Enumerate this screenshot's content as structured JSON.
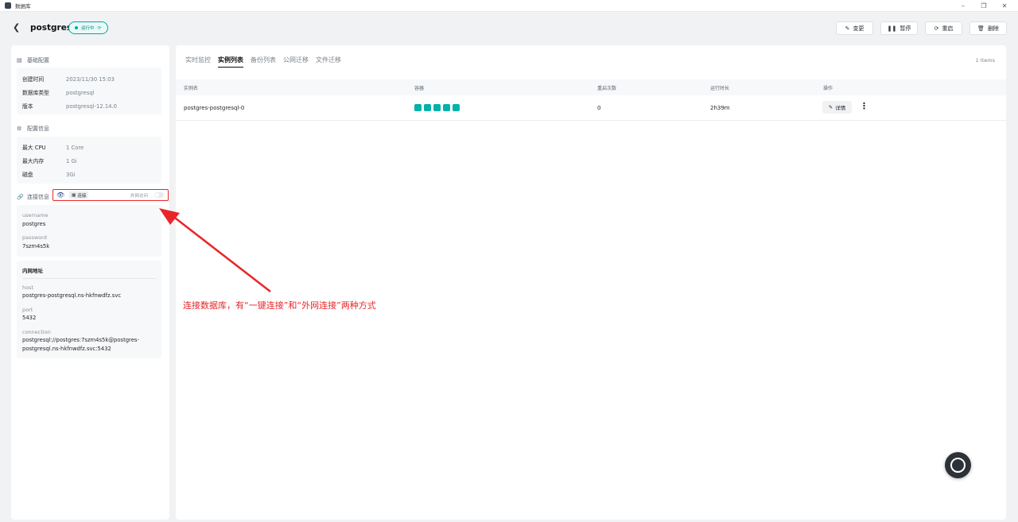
{
  "window": {
    "title": "数据库",
    "controls": [
      "–",
      "❐",
      "✕"
    ]
  },
  "header": {
    "back_icon": "chevron-left-icon",
    "db_name": "postgres",
    "status": "运行中",
    "actions": [
      {
        "label": "变更",
        "icon": "edit-icon"
      },
      {
        "label": "暂停",
        "icon": "pause-icon"
      },
      {
        "label": "重启",
        "icon": "restart-icon"
      },
      {
        "label": "删除",
        "icon": "trash-icon"
      }
    ]
  },
  "basic": {
    "title": "基础配置",
    "rows": [
      {
        "key": "创建时间",
        "value": "2023/11/30 15:03"
      },
      {
        "key": "数据库类型",
        "value": "postgresql"
      },
      {
        "key": "版本",
        "value": "postgresql-12.14.0"
      }
    ]
  },
  "config": {
    "title": "配置信息",
    "rows": [
      {
        "key": "最大 CPU",
        "value": "1 Core"
      },
      {
        "key": "最大内存",
        "value": "1 Gi"
      },
      {
        "key": "磁盘",
        "value": "3Gi"
      }
    ]
  },
  "connection": {
    "title": "连接信息",
    "connect_label": "连接",
    "external_label": "外网访问",
    "username_label": "username",
    "username": "postgres",
    "password_label": "password",
    "password": "7szm4s5k",
    "internal_title": "内网地址",
    "host_label": "host",
    "host": "postgres-postgresql.ns-hkfnwdfz.svc",
    "port_label": "port",
    "port": "5432",
    "connection_label": "connection",
    "connection_line1": "postgresql://postgres:7szm4s5k@postgres-",
    "connection_line2": "postgresql.ns-hkfnwdfz.svc:5432"
  },
  "main": {
    "tabs": [
      {
        "label": "实时监控",
        "active": false
      },
      {
        "label": "实例列表",
        "active": true
      },
      {
        "label": "备份列表",
        "active": false
      },
      {
        "label": "公网迁移",
        "active": false
      },
      {
        "label": "文件迁移",
        "active": false
      }
    ],
    "items_count": "1 Items",
    "table": {
      "headers": [
        "实例名",
        "容器",
        "重启次数",
        "运行时长",
        "操作"
      ],
      "rows": [
        {
          "name": "postgres-postgresql-0",
          "containers": 5,
          "restarts": "0",
          "uptime": "2h39m",
          "detail_label": "详情"
        }
      ]
    }
  },
  "annotation": {
    "text": "连接数据库，有“一键连接”和“外网连接”两种方式",
    "color": "#e8262a"
  },
  "colors": {
    "accent": "#00a9a6",
    "pod": "#00b2aa",
    "annotation": "#e8262a"
  }
}
